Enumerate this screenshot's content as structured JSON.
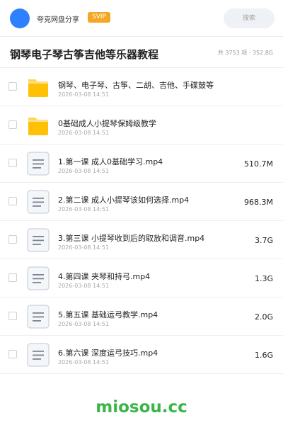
{
  "header": {
    "username": "夸克网盘分享",
    "badge": "SVIP",
    "search_placeholder": "搜索",
    "accent_color": "#2f80ff"
  },
  "folder": {
    "title": "钢琴电子琴古筝吉他等乐器教程",
    "meta": "共 3753 项 · 352.8G"
  },
  "files": [
    {
      "type": "folder",
      "name": "钢琴、电子琴、古筝、二胡、吉他、手碟鼓等",
      "date": "2026-03-08 14:51",
      "size": "",
      "icon": "folder-icon"
    },
    {
      "type": "folder",
      "name": "0基础成人小提琴保姆级教学",
      "date": "2026-03-08 14:51",
      "size": "",
      "icon": "folder-icon"
    },
    {
      "type": "file",
      "name": "1.第一课 成人0基础学习.mp4",
      "date": "2026-03-08 14:51",
      "size": "510.7M",
      "icon": "document-icon"
    },
    {
      "type": "file",
      "name": "2.第二课 成人小提琴该如何选择.mp4",
      "date": "2026-03-08 14:51",
      "size": "968.3M",
      "icon": "document-icon"
    },
    {
      "type": "file",
      "name": "3.第三课 小提琴收到后的取放和调音.mp4",
      "date": "2026-03-08 14:51",
      "size": "3.7G",
      "icon": "document-icon"
    },
    {
      "type": "file",
      "name": "4.第四课 夹琴和持弓.mp4",
      "date": "2026-03-08 14:51",
      "size": "1.3G",
      "icon": "document-icon"
    },
    {
      "type": "file",
      "name": "5.第五课 基础运弓教学.mp4",
      "date": "2026-03-08 14:51",
      "size": "2.0G",
      "icon": "document-icon"
    },
    {
      "type": "file",
      "name": "6.第六课 深度运弓技巧.mp4",
      "date": "2026-03-08 14:51",
      "size": "1.6G",
      "icon": "document-icon"
    }
  ],
  "watermark": "miosou.cc"
}
